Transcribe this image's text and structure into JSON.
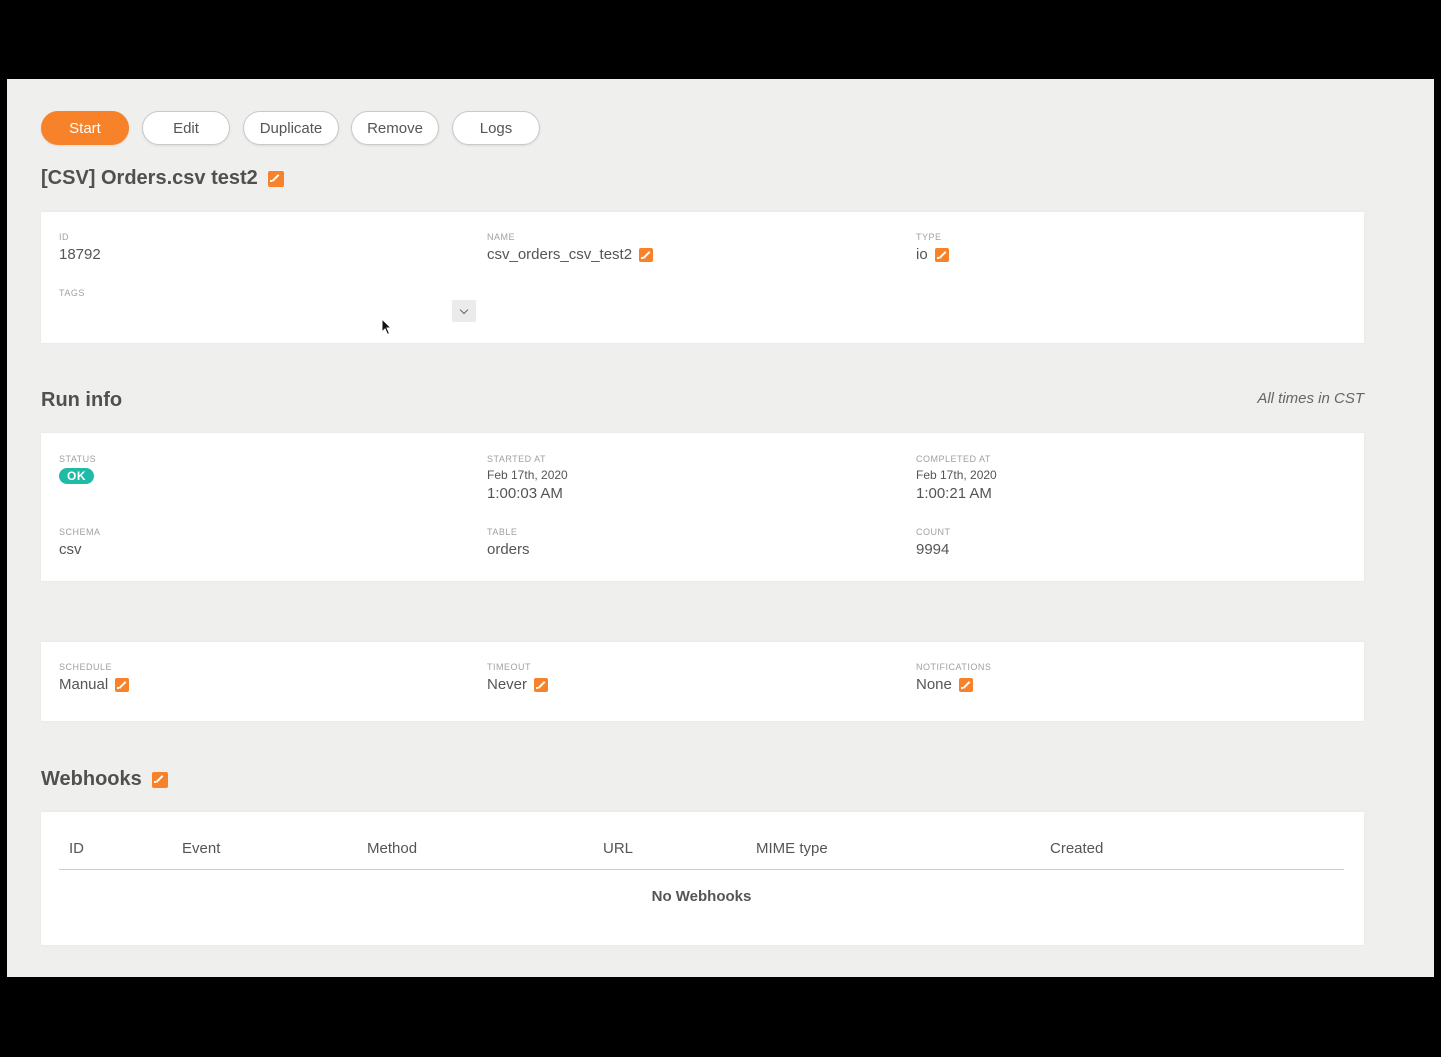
{
  "toolbar": {
    "start": "Start",
    "edit": "Edit",
    "duplicate": "Duplicate",
    "remove": "Remove",
    "logs": "Logs"
  },
  "page_title": "[CSV] Orders.csv test2",
  "details": {
    "id_label": "ID",
    "id_value": "18792",
    "name_label": "NAME",
    "name_value": "csv_orders_csv_test2",
    "type_label": "TYPE",
    "type_value": "io",
    "tags_label": "TAGS"
  },
  "run_info": {
    "heading": "Run info",
    "note": "All times in CST",
    "status_label": "STATUS",
    "status_value": "OK",
    "started_label": "STARTED AT",
    "started_date": "Feb 17th, 2020",
    "started_time": "1:00:03 AM",
    "completed_label": "COMPLETED AT",
    "completed_date": "Feb 17th, 2020",
    "completed_time": "1:00:21 AM",
    "schema_label": "SCHEMA",
    "schema_value": "csv",
    "table_label": "TABLE",
    "table_value": "orders",
    "count_label": "COUNT",
    "count_value": "9994"
  },
  "settings": {
    "schedule_label": "SCHEDULE",
    "schedule_value": "Manual",
    "timeout_label": "TIMEOUT",
    "timeout_value": "Never",
    "notifications_label": "NOTIFICATIONS",
    "notifications_value": "None"
  },
  "webhooks": {
    "heading": "Webhooks",
    "columns": [
      "ID",
      "Event",
      "Method",
      "URL",
      "MIME type",
      "Created"
    ],
    "empty_text": "No Webhooks"
  },
  "colors": {
    "accent": "#f7822a",
    "status_ok": "#1fbba6"
  }
}
